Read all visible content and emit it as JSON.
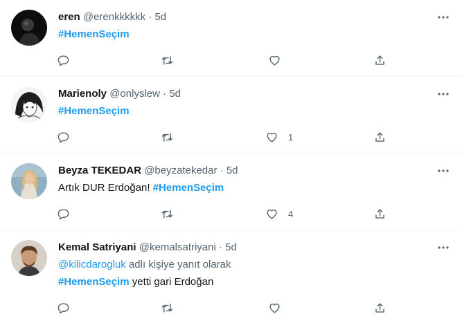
{
  "tweets": [
    {
      "name": "eren",
      "handle": "@erenkkkkkk",
      "separator": "·",
      "time": "5d",
      "reply_prefix": "",
      "reply_mention": "",
      "reply_suffix": "",
      "line1_text": "",
      "hashtag": "#HemenSeçim",
      "line2_text": "",
      "like_count": "",
      "avatar_colors": [
        "#111111",
        "#2a2a2a"
      ]
    },
    {
      "name": "Marienoly",
      "handle": "@onlyslew",
      "separator": "·",
      "time": "5d",
      "hashtag": "#HemenSeçim",
      "line1_text": "",
      "like_count": "1",
      "avatar_colors": [
        "#f2f2f2",
        "#222222"
      ]
    },
    {
      "name": "Beyza TEKEDAR",
      "handle": "@beyzatekedar",
      "separator": "·",
      "time": "5d",
      "line1_text": "Artık DUR Erdoğan!",
      "hashtag": "#HemenSeçim",
      "like_count": "4",
      "avatar_colors": [
        "#7fa3b8",
        "#d9c090"
      ]
    },
    {
      "name": "Kemal Satriyani",
      "handle": "@kemalsatriyani",
      "separator": "·",
      "time": "5d",
      "reply_mention": "@kilicdarogluk",
      "reply_suffix": "adlı kişiye yanıt olarak",
      "hashtag": "#HemenSeçim",
      "line2_text": "yetti gari Erdoğan",
      "like_count": "",
      "avatar_colors": [
        "#d8d2c8",
        "#6b4a36"
      ]
    }
  ],
  "icons": {
    "reply": "reply-icon",
    "retweet": "retweet-icon",
    "like": "heart-icon",
    "share": "share-icon",
    "more": "more-icon"
  },
  "colors": {
    "accent": "#1d9bf0",
    "secondary_text": "#536471",
    "divider": "#eff3f4"
  }
}
